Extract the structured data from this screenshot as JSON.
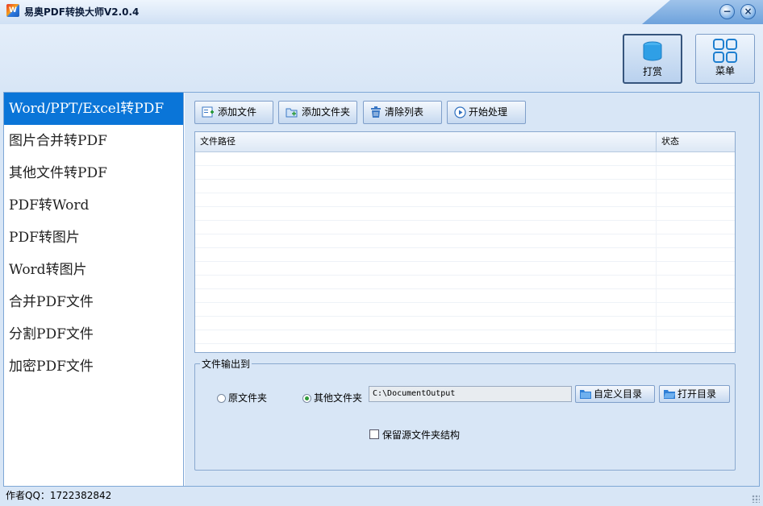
{
  "window": {
    "title": "易奥PDF转换大师V2.0.4",
    "app_icon_text": "W",
    "minimize": "−",
    "close": "×"
  },
  "toolbar": {
    "reward_label": "打赏",
    "menu_label": "菜单"
  },
  "sidebar": {
    "items": [
      {
        "label": "Word/PPT/Excel转PDF",
        "active": true
      },
      {
        "label": "图片合并转PDF"
      },
      {
        "label": "其他文件转PDF"
      },
      {
        "label": "PDF转Word"
      },
      {
        "label": "PDF转图片"
      },
      {
        "label": "Word转图片"
      },
      {
        "label": "合并PDF文件"
      },
      {
        "label": "分割PDF文件"
      },
      {
        "label": "加密PDF文件"
      }
    ]
  },
  "actions": {
    "add_file": "添加文件",
    "add_folder": "添加文件夹",
    "clear_list": "清除列表",
    "start": "开始处理"
  },
  "file_table": {
    "columns": [
      "文件路径",
      "状态"
    ],
    "rows": []
  },
  "output": {
    "legend": "文件输出到",
    "option_source": "原文件夹",
    "option_other": "其他文件夹",
    "selected": "其他文件夹",
    "path_value": "C:\\DocumentOutput",
    "custom_dir_button": "自定义目录",
    "open_dir_button": "打开目录",
    "keep_structure_label": "保留源文件夹结构",
    "keep_structure_checked": false
  },
  "statusbar": {
    "text": "作者QQ：1722382842"
  },
  "colors": {
    "accent": "#0a75d8",
    "background": "#d8e6f6"
  }
}
